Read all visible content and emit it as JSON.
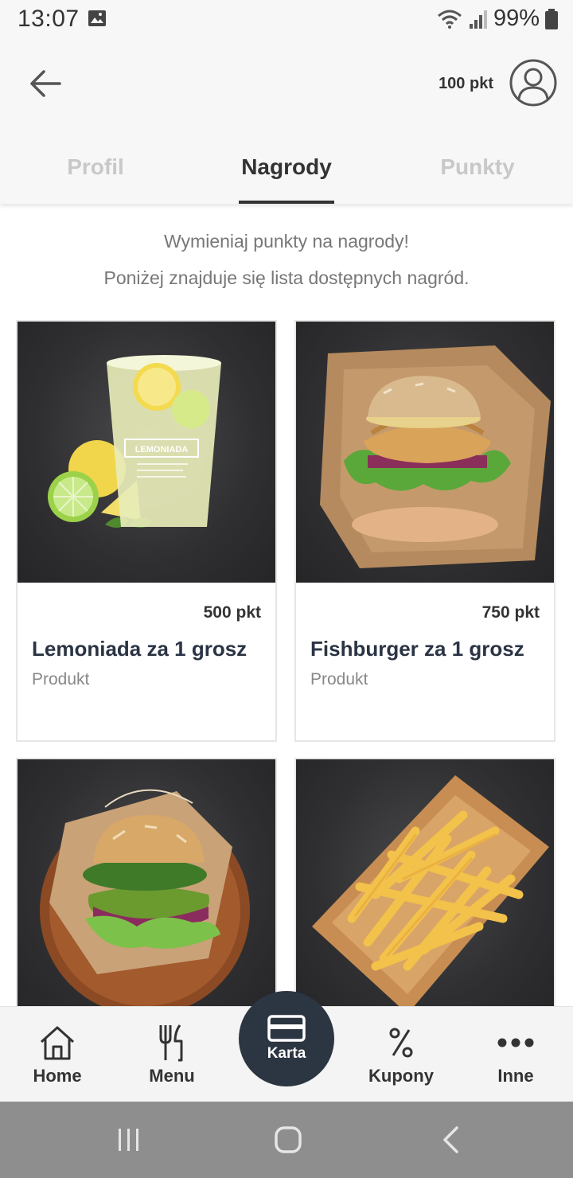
{
  "status_bar": {
    "time": "13:07",
    "battery": "99%",
    "icons": [
      "gallery-icon",
      "wifi-icon",
      "signal-icon",
      "battery-icon"
    ]
  },
  "header": {
    "points": "100 pkt",
    "back_icon": "arrow-left-icon",
    "avatar_icon": "user-circle-icon"
  },
  "tabs": [
    {
      "label": "Profil",
      "active": false
    },
    {
      "label": "Nagrody",
      "active": true
    },
    {
      "label": "Punkty",
      "active": false
    }
  ],
  "intro": {
    "line1": "Wymieniaj punkty na nagrody!",
    "line2": "Poniżej znajduje się lista dostępnych nagród."
  },
  "rewards": [
    {
      "price": "500 pkt",
      "title": "Lemoniada za 1 grosz",
      "type": "Produkt",
      "image": "lemonade",
      "cup_label": "LEMONIADA"
    },
    {
      "price": "750 pkt",
      "title": "Fishburger za 1 grosz",
      "type": "Produkt",
      "image": "fishburger"
    },
    {
      "image": "veggie-burger"
    },
    {
      "image": "fries"
    }
  ],
  "bottom_nav": {
    "items": [
      {
        "label": "Home",
        "icon": "home-icon"
      },
      {
        "label": "Menu",
        "icon": "fork-knife-icon"
      },
      {
        "label": "Karta",
        "icon": "card-icon",
        "active": true
      },
      {
        "label": "Kupony",
        "icon": "percent-icon"
      },
      {
        "label": "Inne",
        "icon": "more-dots-icon"
      }
    ]
  },
  "colors": {
    "accent_dark": "#2c3542",
    "tab_inactive": "#c8c8c8",
    "header_bg": "#f7f7f7"
  }
}
